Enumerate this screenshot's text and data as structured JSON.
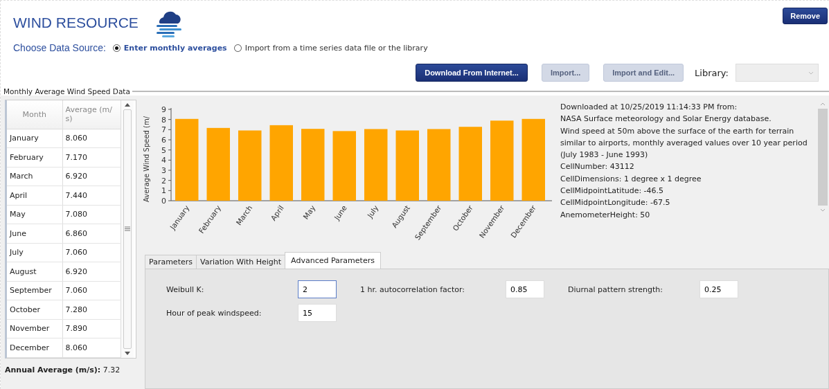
{
  "header": {
    "title": "WIND RESOURCE",
    "remove_button": "Remove"
  },
  "data_source": {
    "label": "Choose Data Source:",
    "options": [
      {
        "label": "Enter monthly averages",
        "selected": true
      },
      {
        "label": "Import from a time series data file or the library",
        "selected": false
      }
    ]
  },
  "toolbar": {
    "buttons": [
      {
        "label": "Download From Internet...",
        "disabled": false
      },
      {
        "label": "Import...",
        "disabled": true
      },
      {
        "label": "Import and Edit...",
        "disabled": true
      }
    ],
    "library_label": "Library:"
  },
  "group": {
    "title": "Monthly Average Wind Speed Data"
  },
  "table": {
    "columns": [
      "Month",
      "Average (m/ s)"
    ],
    "rows": [
      [
        "January",
        "8.060"
      ],
      [
        "February",
        "7.170"
      ],
      [
        "March",
        "6.920"
      ],
      [
        "April",
        "7.440"
      ],
      [
        "May",
        "7.080"
      ],
      [
        "June",
        "6.860"
      ],
      [
        "July",
        "7.060"
      ],
      [
        "August",
        "6.920"
      ],
      [
        "September",
        "7.060"
      ],
      [
        "October",
        "7.280"
      ],
      [
        "November",
        "7.890"
      ],
      [
        "December",
        "8.060"
      ]
    ]
  },
  "annual_average": {
    "label": "Annual Average (m/s):",
    "value": "7.32"
  },
  "chart": {
    "chart_data": {
      "type": "bar",
      "ylabel": "Average Wind Speed (m/",
      "categories": [
        "January",
        "February",
        "March",
        "April",
        "May",
        "June",
        "July",
        "August",
        "September",
        "October",
        "November",
        "December"
      ],
      "series": [
        {
          "color": "#ffa500",
          "values": [
            8.06,
            7.17,
            6.92,
            7.44,
            7.08,
            6.86,
            7.06,
            6.92,
            7.06,
            7.28,
            7.89,
            8.06
          ]
        }
      ],
      "ylim": [
        0,
        9
      ],
      "yticks": [
        0,
        1,
        2,
        3,
        4,
        5,
        6,
        7,
        8,
        9
      ]
    }
  },
  "info_lines": [
    "Downloaded at 10/25/2019 11:14:33 PM from:",
    "NASA Surface meteorology and Solar Energy database.",
    "Wind speed at 50m above the surface of the earth for terrain similar to airports, monthly averaged values over 10 year period (July 1983 - June 1993)",
    "CellNumber: 43112",
    "CellDimensions: 1 degree x 1 degree",
    "CellMidpointLatitude: -46.5",
    "CellMidpointLongitude: -67.5",
    "AnemometerHeight: 50"
  ],
  "tabs": [
    {
      "label": "Parameters",
      "selected": false
    },
    {
      "label": "Variation With Height",
      "selected": false
    },
    {
      "label": "Advanced Parameters",
      "selected": true
    }
  ],
  "fields": [
    {
      "label": "Weibull K:",
      "value": "2",
      "focused": true
    },
    {
      "label": "1 hr. autocorrelation factor:",
      "value": "0.85",
      "focused": false
    },
    {
      "label": "Diurnal pattern strength:",
      "value": "0.25",
      "focused": false
    },
    {
      "label": "Hour of peak windspeed:",
      "value": "15",
      "focused": false
    }
  ]
}
